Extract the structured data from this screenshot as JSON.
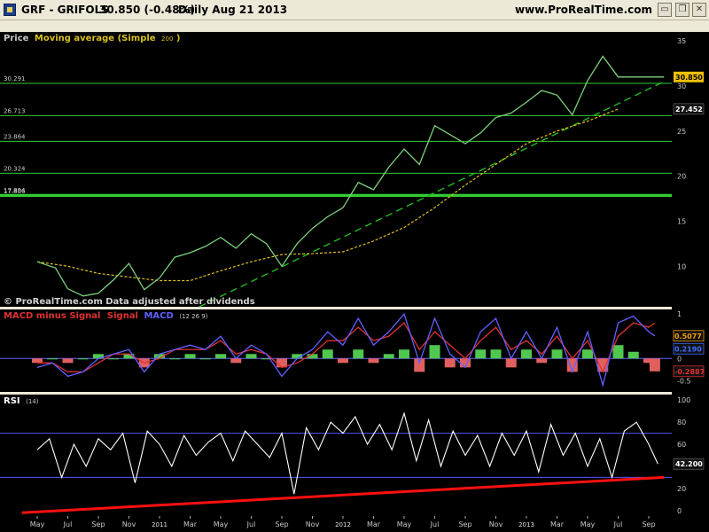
{
  "header": {
    "symbol": "GRF - GRIFOLS",
    "price": "30.850 (-0.48%)",
    "period": "Daily  Aug 21 2013",
    "site": "www.ProRealTime.com"
  },
  "chart_data": [
    {
      "type": "line",
      "panel": "price",
      "title": "Price  Moving average (Simple 200)",
      "title_parts": {
        "price": "Price",
        "ma": "Moving average (Simple",
        "ma_period": "200",
        "ma_close": ")"
      },
      "watermark": "© ProRealTime.com  Data adjusted after dividends",
      "x_ticks": [
        "May",
        "Jul",
        "Sep",
        "Nov",
        "2011",
        "Mar",
        "May",
        "Jul",
        "Sep",
        "Nov",
        "2012",
        "Mar",
        "May",
        "Jul",
        "Sep",
        "Nov",
        "2013",
        "Mar",
        "May",
        "Jul",
        "Sep"
      ],
      "y_ticks": [
        10,
        15,
        20,
        25,
        30,
        35
      ],
      "ylim": [
        5.5,
        36
      ],
      "horizontal_levels": [
        {
          "label": "30.291",
          "value": 30.291
        },
        {
          "label": "26.713",
          "value": 26.713
        },
        {
          "label": "23.864",
          "value": 23.864
        },
        {
          "label": "20.324",
          "value": 20.324
        },
        {
          "label": "17.894",
          "value": 17.894
        },
        {
          "label": "17.806",
          "value": 17.806
        }
      ],
      "last_price_label": "30.850",
      "ma_last_label": "27.452",
      "series": [
        {
          "name": "Price",
          "x_ticks_index": [
            0,
            0.6,
            1,
            1.5,
            2,
            2.5,
            3,
            3.5,
            4,
            4.5,
            5,
            5.5,
            6,
            6.5,
            7,
            7.5,
            8,
            8.5,
            9,
            9.5,
            10,
            10.5,
            11,
            11.5,
            12,
            12.5,
            13,
            13.5,
            14,
            14.5,
            15,
            15.5,
            16,
            16.5,
            17,
            17.5,
            18,
            18.5,
            19,
            19.5,
            20,
            20.5
          ],
          "values": [
            10.5,
            9.8,
            7.5,
            6.7,
            7.0,
            8.5,
            10.3,
            7.4,
            8.7,
            11.0,
            11.5,
            12.2,
            13.2,
            12.0,
            13.6,
            12.5,
            10.0,
            12.5,
            14.2,
            15.5,
            16.5,
            19.3,
            18.5,
            21.0,
            23.0,
            21.3,
            25.6,
            24.6,
            23.6,
            24.8,
            26.5,
            27.0,
            28.2,
            29.5,
            29.0,
            26.8,
            30.6,
            33.3,
            31.0,
            31.0,
            31.0,
            31.0
          ]
        },
        {
          "name": "Moving average (Simple 200)",
          "x_ticks_index": [
            0,
            1,
            2,
            3,
            4,
            5,
            6,
            7,
            8,
            9,
            10,
            11,
            12,
            13,
            14,
            15,
            16,
            17,
            18,
            19
          ],
          "values": [
            10.5,
            10.0,
            9.2,
            8.8,
            8.4,
            8.4,
            9.5,
            10.5,
            11.3,
            11.4,
            11.6,
            12.8,
            14.3,
            16.5,
            19.0,
            21.3,
            23.6,
            25.0,
            26.1,
            27.452
          ]
        }
      ],
      "trendline": {
        "x_ticks_index": [
          5.3,
          20.5
        ],
        "values": [
          5.5,
          30.5
        ]
      }
    },
    {
      "type": "bar",
      "panel": "macd",
      "title": "MACD minus Signal  Signal  MACD",
      "title_parts": {
        "hist": "MACD minus Signal",
        "signal": "Signal",
        "macd": "MACD",
        "params": "(12 26 9)"
      },
      "y_ticks": [
        -0.5,
        0,
        0.5,
        1
      ],
      "ylim": [
        -0.75,
        1.1
      ],
      "labels": [
        "0.5077",
        "0.2190",
        "-0.2887"
      ],
      "series": [
        {
          "name": "MACD",
          "x_ticks_index": [
            0,
            0.5,
            1,
            1.5,
            2,
            2.5,
            3,
            3.5,
            4,
            4.5,
            5,
            5.5,
            6,
            6.5,
            7,
            7.5,
            8,
            8.5,
            9,
            9.5,
            10,
            10.5,
            11,
            11.5,
            12,
            12.5,
            13,
            13.5,
            14,
            14.5,
            15,
            15.5,
            16,
            16.5,
            17,
            17.5,
            18,
            18.5,
            19,
            19.5,
            20,
            20.2
          ],
          "values": [
            -0.2,
            -0.1,
            -0.4,
            -0.3,
            0.0,
            0.1,
            0.2,
            -0.3,
            0.1,
            0.2,
            0.3,
            0.2,
            0.5,
            0.0,
            0.3,
            0.1,
            -0.4,
            0.0,
            0.2,
            0.6,
            0.3,
            0.9,
            0.3,
            0.6,
            1.0,
            -0.1,
            0.9,
            0.1,
            -0.2,
            0.6,
            0.9,
            0.0,
            0.6,
            0.0,
            0.7,
            -0.3,
            0.6,
            -0.6,
            0.8,
            0.95,
            0.6,
            0.5077
          ]
        },
        {
          "name": "Signal",
          "x_ticks_index": [
            0,
            0.5,
            1,
            1.5,
            2,
            2.5,
            3,
            3.5,
            4,
            4.5,
            5,
            5.5,
            6,
            6.5,
            7,
            7.5,
            8,
            8.5,
            9,
            9.5,
            10,
            10.5,
            11,
            11.5,
            12,
            12.5,
            13,
            13.5,
            14,
            14.5,
            15,
            15.5,
            16,
            16.5,
            17,
            17.5,
            18,
            18.5,
            19,
            19.5,
            20,
            20.2
          ],
          "values": [
            -0.1,
            -0.1,
            -0.3,
            -0.3,
            -0.1,
            0.1,
            0.1,
            -0.1,
            0.0,
            0.2,
            0.2,
            0.2,
            0.4,
            0.1,
            0.2,
            0.1,
            -0.2,
            -0.1,
            0.1,
            0.4,
            0.4,
            0.7,
            0.4,
            0.5,
            0.8,
            0.2,
            0.6,
            0.3,
            0.0,
            0.4,
            0.7,
            0.2,
            0.4,
            0.1,
            0.5,
            0.0,
            0.4,
            -0.3,
            0.5,
            0.8,
            0.7,
            0.7964
          ]
        }
      ]
    },
    {
      "type": "line",
      "panel": "rsi",
      "title": "RSI",
      "title_parts": {
        "name": "RSI",
        "params": "(14)"
      },
      "y_ticks": [
        0,
        20,
        40,
        60,
        80,
        100
      ],
      "ylim": [
        -5,
        105
      ],
      "levels": [
        30,
        70
      ],
      "last_label": "42.200",
      "series": [
        {
          "name": "RSI",
          "x_ticks_index": [
            0,
            0.4,
            0.8,
            1.2,
            1.6,
            2,
            2.4,
            2.8,
            3.2,
            3.6,
            4,
            4.4,
            4.8,
            5.2,
            5.6,
            6,
            6.4,
            6.8,
            7.2,
            7.6,
            8,
            8.4,
            8.8,
            9.2,
            9.6,
            10,
            10.4,
            10.8,
            11.2,
            11.6,
            12,
            12.4,
            12.8,
            13.2,
            13.6,
            14,
            14.4,
            14.8,
            15.2,
            15.6,
            16,
            16.4,
            16.8,
            17.2,
            17.6,
            18,
            18.4,
            18.8,
            19.2,
            19.6,
            20,
            20.3
          ],
          "values": [
            55,
            65,
            30,
            60,
            40,
            65,
            55,
            70,
            25,
            72,
            60,
            40,
            68,
            50,
            62,
            70,
            45,
            72,
            60,
            48,
            70,
            15,
            75,
            55,
            80,
            70,
            85,
            60,
            78,
            55,
            88,
            45,
            82,
            40,
            72,
            50,
            68,
            40,
            70,
            50,
            72,
            35,
            78,
            50,
            70,
            40,
            65,
            30,
            72,
            80,
            60,
            42.2
          ]
        }
      ],
      "trendline": {
        "x_ticks_index": [
          -0.5,
          20.5
        ],
        "values": [
          -2,
          30
        ]
      }
    }
  ],
  "colors": {
    "panel_bg": "#000000",
    "frame_bg": "#ece9d8",
    "level_line": "#33cc33",
    "ma": "#e0c020",
    "trend_green": "#22bb22",
    "macd_line": "#6060ff",
    "signal_line": "#e03030",
    "hist_pos": "#50c850",
    "hist_neg": "#e06060",
    "rsi_line": "#ffffff",
    "rsi_trend": "#ff1010",
    "title_price": "#c8c8c8",
    "title_ma": "#d8c020",
    "title_macd_hist": "#e03030",
    "title_macd": "#6060ff"
  }
}
